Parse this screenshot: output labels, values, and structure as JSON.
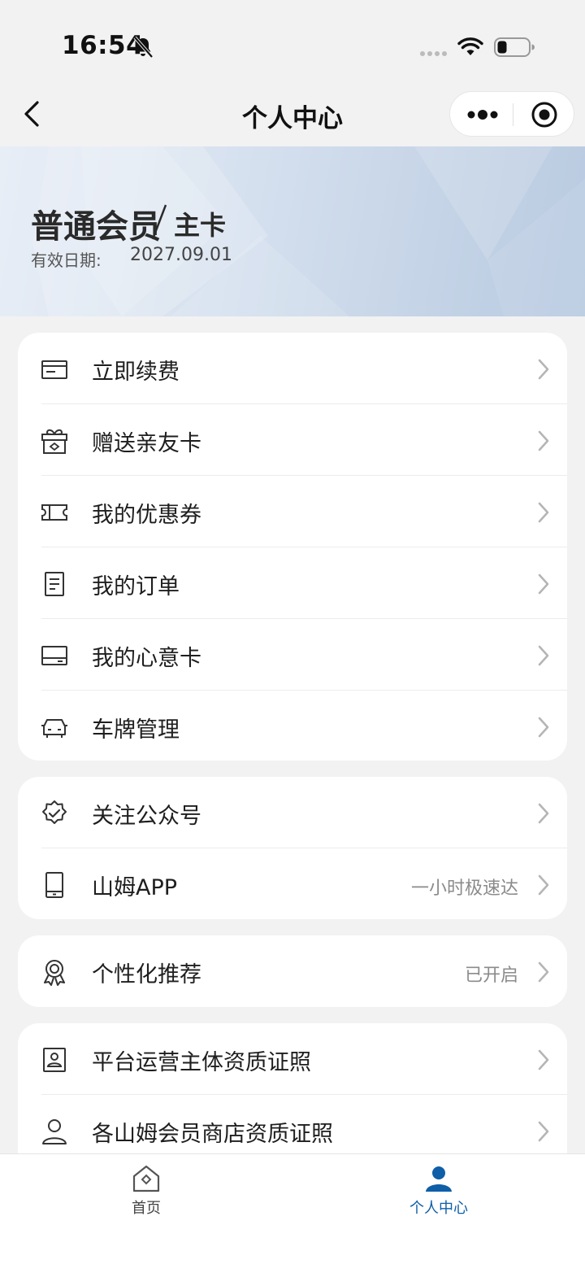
{
  "status_bar": {
    "time": "16:54"
  },
  "nav": {
    "title": "个人中心"
  },
  "membership": {
    "level": "普通会员",
    "card_type": "主卡",
    "valid_label": "有效日期:",
    "valid_date": "2027.09.01"
  },
  "menu_group_1": [
    {
      "label": "立即续费",
      "icon": "card-icon"
    },
    {
      "label": "赠送亲友卡",
      "icon": "gift-icon"
    },
    {
      "label": "我的优惠券",
      "icon": "coupon-icon"
    },
    {
      "label": "我的订单",
      "icon": "order-icon"
    },
    {
      "label": "我的心意卡",
      "icon": "gift-card-icon"
    },
    {
      "label": "车牌管理",
      "icon": "car-icon"
    }
  ],
  "menu_group_2": [
    {
      "label": "关注公众号",
      "icon": "badge-check-icon"
    },
    {
      "label": "山姆APP",
      "hint": "一小时极速达",
      "icon": "phone-icon"
    }
  ],
  "menu_group_3": [
    {
      "label": "个性化推荐",
      "hint": "已开启",
      "icon": "award-icon"
    }
  ],
  "menu_group_4": [
    {
      "label": "平台运营主体资质证照",
      "icon": "id-card-icon"
    },
    {
      "label": "各山姆会员商店资质证照",
      "icon": "person-icon"
    }
  ],
  "tab_bar": {
    "home_label": "首页",
    "profile_label": "个人中心",
    "active_color": "#0f5ea8"
  }
}
